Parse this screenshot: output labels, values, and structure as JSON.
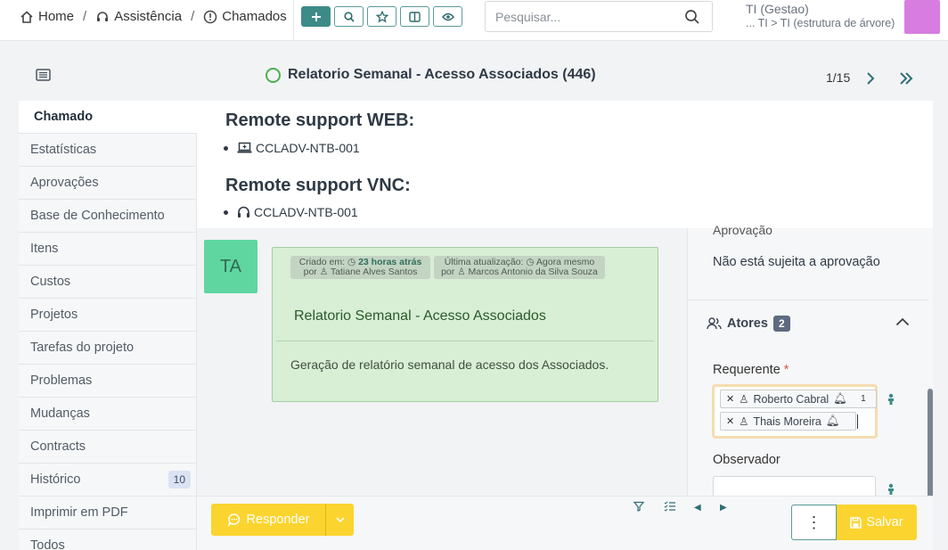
{
  "breadcrumb": {
    "home": "Home",
    "assistance": "Assistência",
    "tickets": "Chamados",
    "separator": "/"
  },
  "search": {
    "placeholder": "Pesquisar..."
  },
  "entity": {
    "name": "TI (Gestao)",
    "path": "... TI > TI (estrutura de árvore)"
  },
  "colors": {
    "accent": "#3d8b88",
    "yellow": "#fbd42f",
    "avatar": "#d77de0",
    "followup_bg": "#d8eed5",
    "ta_avatar": "#5fd6a0"
  },
  "ticket": {
    "title": "Relatorio Semanal - Acesso Associados (446)",
    "pager": "1/15"
  },
  "tabs": [
    {
      "label": "Chamado"
    },
    {
      "label": "Estatísticas"
    },
    {
      "label": "Aprovações"
    },
    {
      "label": "Base de Conhecimento"
    },
    {
      "label": "Itens"
    },
    {
      "label": "Custos"
    },
    {
      "label": "Projetos"
    },
    {
      "label": "Tarefas do projeto"
    },
    {
      "label": "Problemas"
    },
    {
      "label": "Mudanças"
    },
    {
      "label": "Contracts"
    },
    {
      "label": "Histórico",
      "badge": "10"
    },
    {
      "label": "Imprimir em PDF"
    },
    {
      "label": "Todos"
    }
  ],
  "description": {
    "web_heading": "Remote support WEB:",
    "web_item": "CCLADV-NTB-001",
    "vnc_heading": "Remote support VNC:",
    "vnc_item": "CCLADV-NTB-001"
  },
  "followup": {
    "avatar_initials": "TA",
    "created_label": "Criado em:",
    "created_time": "23 horas atrás",
    "created_by_label": "por",
    "created_by": "Tatiane Alves Santos",
    "updated_label": "Última atualização:",
    "updated_time": "Agora mesmo",
    "updated_by_label": "por",
    "updated_by": "Marcos Antonio da Silva Souza",
    "title": "Relatorio Semanal - Acesso Associados",
    "body": "Geração de relatório semanal de acesso dos Associados."
  },
  "right_panel": {
    "approval_heading": "Aprovação",
    "approval_value": "Não está sujeita a aprovação",
    "actors_label": "Atores",
    "actors_count": "2",
    "requester_label": "Requerente",
    "required_mark": "*",
    "requesters": [
      {
        "name": "Roberto Cabral",
        "count": "1"
      },
      {
        "name": "Thais Moreira"
      }
    ],
    "observer_label": "Observador"
  },
  "actions": {
    "reply": "Responder",
    "save": "Salvar"
  }
}
